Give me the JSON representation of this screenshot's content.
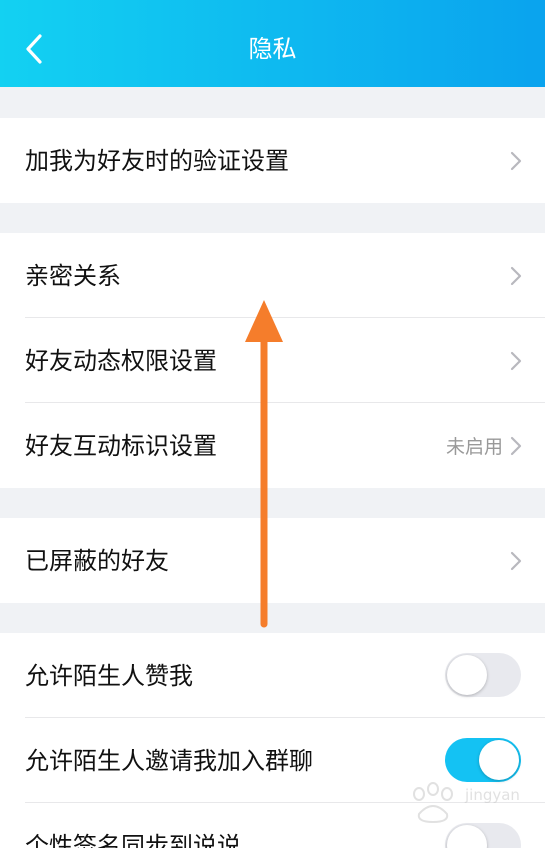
{
  "header": {
    "title": "隐私",
    "back_icon": "chevron-left-icon",
    "gradient": [
      "#13d1f2",
      "#0aa3ee"
    ]
  },
  "groups": [
    {
      "items": [
        {
          "label": "加我为好友时的验证设置",
          "control": "chevron"
        }
      ]
    },
    {
      "items": [
        {
          "label": "亲密关系",
          "control": "chevron"
        },
        {
          "label": "好友动态权限设置",
          "control": "chevron"
        },
        {
          "label": "好友互动标识设置",
          "status": "未启用",
          "control": "chevron"
        }
      ]
    },
    {
      "items": [
        {
          "label": "已屏蔽的好友",
          "control": "chevron"
        }
      ]
    },
    {
      "items": [
        {
          "label": "允许陌生人赞我",
          "control": "toggle",
          "on": false
        },
        {
          "label": "允许陌生人邀请我加入群聊",
          "control": "toggle",
          "on": true
        },
        {
          "label": "个性签名同步到说说",
          "control": "toggle",
          "on": false
        }
      ]
    }
  ],
  "annotation": {
    "type": "upward-arrow",
    "color": "#f57d2b"
  },
  "watermark": {
    "text": "jingyan",
    "logo": "Baidu"
  },
  "colors": {
    "toggle_on": "#14c2f3",
    "toggle_off": "#e8e9ee",
    "chevron": "#b8b8be",
    "status_text": "#999999"
  }
}
